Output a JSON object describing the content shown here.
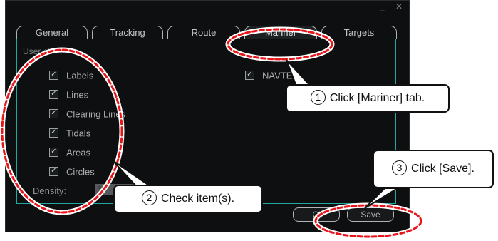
{
  "window": {
    "controls": "_ ✕",
    "tabs": [
      "General",
      "Tracking",
      "Route",
      "Mariner",
      "Targets"
    ],
    "active_tab": "Mariner"
  },
  "left_group": {
    "label": "User ch",
    "items": [
      {
        "label": "Labels",
        "checked": true
      },
      {
        "label": "Lines",
        "checked": true
      },
      {
        "label": "Clearing Lines",
        "checked": true
      },
      {
        "label": "Tidals",
        "checked": true
      },
      {
        "label": "Areas",
        "checked": true
      },
      {
        "label": "Circles",
        "checked": true
      }
    ],
    "density_label": "Density:",
    "density_value": "%"
  },
  "right_group": {
    "items": [
      {
        "label": "NAVTE",
        "checked": true
      }
    ]
  },
  "buttons": {
    "close": "Cl",
    "save": "Save"
  },
  "callouts": {
    "step1": {
      "num": "1",
      "text": "Click [Mariner] tab."
    },
    "step2": {
      "num": "2",
      "text": "Check item(s)."
    },
    "step3": {
      "num": "3",
      "text": "Click [Save]."
    }
  },
  "colors": {
    "highlight": "#e8151b",
    "panel_border": "#22a8a0",
    "window_bg": "#0e0f10"
  }
}
